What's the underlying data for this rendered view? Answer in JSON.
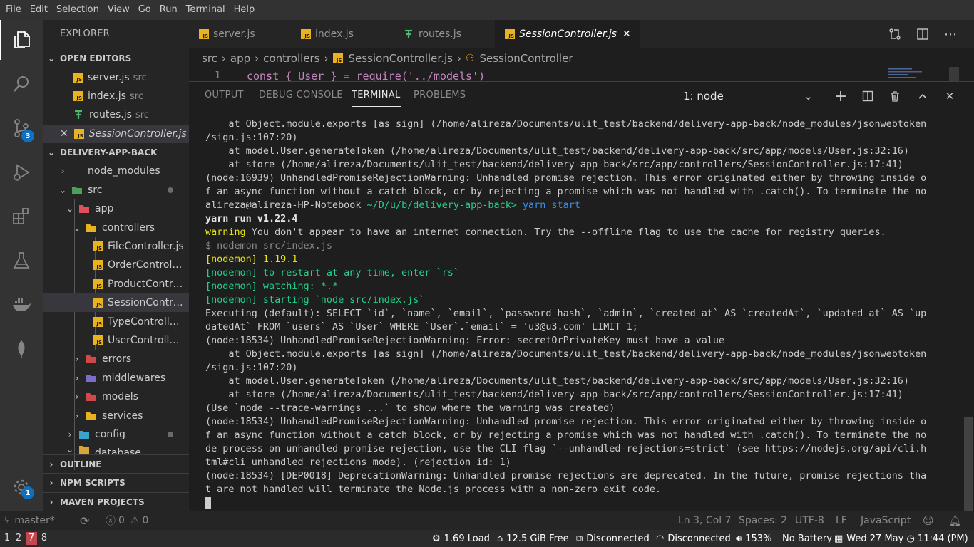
{
  "menu": [
    "File",
    "Edit",
    "Selection",
    "View",
    "Go",
    "Run",
    "Terminal",
    "Help"
  ],
  "activity": {
    "scm_badge": "3",
    "settings_badge": "1"
  },
  "sidebar": {
    "title": "EXPLORER",
    "open_editors": {
      "label": "OPEN EDITORS",
      "items": [
        {
          "name": "server.js",
          "hint": "src"
        },
        {
          "name": "index.js",
          "hint": "src"
        },
        {
          "name": "routes.js",
          "hint": "src"
        },
        {
          "name": "SessionController.js",
          "hint": "src/app/controllers"
        }
      ]
    },
    "project": {
      "label": "DELIVERY-APP-BACK",
      "items": {
        "node_modules": "node_modules",
        "src": "src",
        "app": "app",
        "controllers": "controllers",
        "file_ctrl": "FileController.js",
        "order_ctrl": "OrderController.js",
        "product_ctrl": "ProductController.js",
        "session_ctrl": "SessionController.js",
        "type_ctrl": "TypeController.js",
        "user_ctrl": "UserController.js",
        "errors": "errors",
        "middlewares": "middlewares",
        "models": "models",
        "services": "services",
        "config": "config",
        "database": "database"
      }
    },
    "outline": "OUTLINE",
    "npm": "NPM SCRIPTS",
    "maven": "MAVEN PROJECTS"
  },
  "tabs": [
    {
      "name": "server.js"
    },
    {
      "name": "index.js"
    },
    {
      "name": "routes.js"
    },
    {
      "name": "SessionController.js"
    }
  ],
  "breadcrumbs": [
    "src",
    "app",
    "controllers",
    "SessionController.js",
    "SessionController"
  ],
  "editor": {
    "line_number": "1",
    "code": "const { User } = require('../models')"
  },
  "panel": {
    "tabs": [
      "OUTPUT",
      "DEBUG CONSOLE",
      "TERMINAL",
      "PROBLEMS"
    ],
    "terminal_select": "1: node",
    "lines": [
      "    at Object.module.exports [as sign] (/home/alireza/Documents/ulit_test/backend/delivery-app-back/node_modules/jsonwebtoken",
      "/sign.js:107:20)",
      "    at model.User.generateToken (/home/alireza/Documents/ulit_test/backend/delivery-app-back/src/app/models/User.js:32:16)",
      "    at store (/home/alireza/Documents/ulit_test/backend/delivery-app-back/src/app/controllers/SessionController.js:17:41)",
      "(node:16939) UnhandledPromiseRejectionWarning: Unhandled promise rejection. This error originated either by throwing inside o",
      "f an async function without a catch block, or by rejecting a promise which was not handled with .catch(). To terminate the no",
      "PROMPT",
      "yarn run v1.22.4",
      "WARNING",
      "$ nodemon src/index.js",
      "[nodemon] 1.19.1",
      "[nodemon] to restart at any time, enter `rs`",
      "[nodemon] watching: *.*",
      "[nodemon] starting `node src/index.js`",
      "Executing (default): SELECT `id`, `name`, `email`, `password_hash`, `admin`, `created_at` AS `createdAt`, `updated_at` AS `up",
      "datedAt` FROM `users` AS `User` WHERE `User`.`email` = 'u3@u3.com' LIMIT 1;",
      "(node:18534) UnhandledPromiseRejectionWarning: Error: secretOrPrivateKey must have a value",
      "    at Object.module.exports [as sign] (/home/alireza/Documents/ulit_test/backend/delivery-app-back/node_modules/jsonwebtoken",
      "/sign.js:107:20)",
      "    at model.User.generateToken (/home/alireza/Documents/ulit_test/backend/delivery-app-back/src/app/models/User.js:32:16)",
      "    at store (/home/alireza/Documents/ulit_test/backend/delivery-app-back/src/app/controllers/SessionController.js:17:41)",
      "(Use `node --trace-warnings ...` to show where the warning was created)",
      "(node:18534) UnhandledPromiseRejectionWarning: Unhandled promise rejection. This error originated either by throwing inside o",
      "f an async function without a catch block, or by rejecting a promise which was not handled with .catch(). To terminate the no",
      "de process on unhandled promise rejection, use the CLI flag `--unhandled-rejections=strict` (see https://nodejs.org/api/cli.h",
      "tml#cli_unhandled_rejections_mode). (rejection id: 1)",
      "(node:18534) [DEP0018] DeprecationWarning: Unhandled promise rejections are deprecated. In the future, promise rejections tha",
      "t are not handled will terminate the Node.js process with a non-zero exit code."
    ],
    "prompt_user": "alireza@alireza-HP-Notebook",
    "prompt_path": "~/D/u/b/delivery-app-back>",
    "prompt_cmd": "yarn start",
    "warning_word": "warning",
    "warning_text": " You don't appear to have an internet connection. Try the --offline flag to use the cache for registry queries."
  },
  "status": {
    "branch": "master*",
    "errors": "0",
    "warnings": "0",
    "position": "Ln 3, Col 7",
    "spaces": "Spaces: 2",
    "encoding": "UTF-8",
    "eol": "LF",
    "language": "JavaScript"
  },
  "system": {
    "workspaces": [
      "1",
      "2",
      "7",
      "8"
    ],
    "load": "1.69 Load",
    "free": "12.5 GiB Free",
    "net1": "Disconnected",
    "net2": "Disconnected",
    "volume": "153%",
    "battery": "No Battery",
    "clock": "Wed 27 May ◷ 11:44 (PM)"
  },
  "colors": {
    "accent": "#0e70c0",
    "js_icon": "#e8b220",
    "terminal_green": "#23d18b",
    "terminal_yellow": "#e5e510",
    "terminal_blue": "#3b8eea",
    "active_workspace": "#c4474f"
  }
}
